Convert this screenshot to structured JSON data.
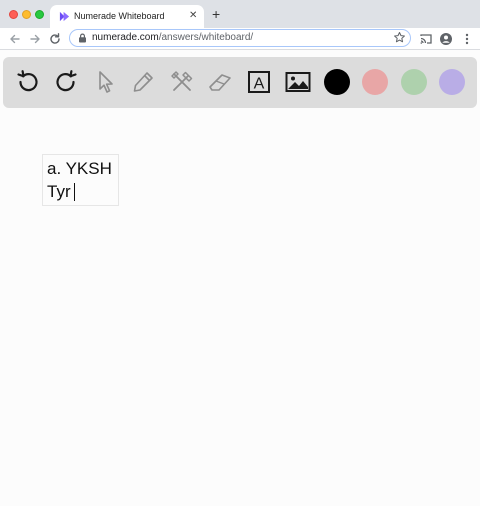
{
  "browser": {
    "tab": {
      "title": "Numerade Whiteboard",
      "close_glyph": "✕"
    },
    "new_tab_glyph": "+",
    "address": {
      "host": "numerade.com",
      "path": "/answers/whiteboard/"
    }
  },
  "toolbar": {
    "tools": [
      {
        "name": "undo-icon"
      },
      {
        "name": "redo-icon"
      },
      {
        "name": "cursor-icon"
      },
      {
        "name": "pen-icon"
      },
      {
        "name": "tools-icon"
      },
      {
        "name": "eraser-icon"
      },
      {
        "name": "text-tool-icon",
        "glyph": "A"
      },
      {
        "name": "image-icon"
      }
    ],
    "colors": {
      "black": "#000000",
      "red": "#e8a6a6",
      "green": "#aed1ad",
      "purple": "#b9ade6"
    }
  },
  "canvas": {
    "text_lines": [
      "a. YKSH",
      "Tyr"
    ]
  }
}
